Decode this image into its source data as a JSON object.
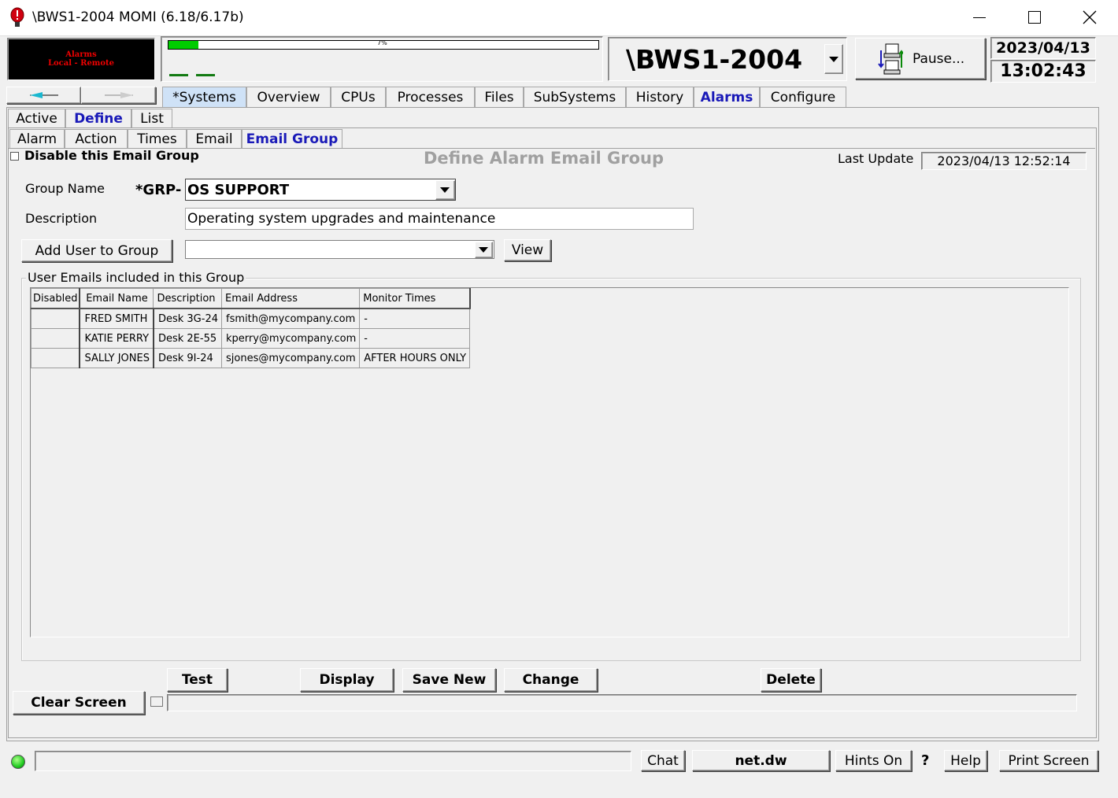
{
  "window": {
    "title": "\\BWS1-2004 MOMI (6.18/6.17b)",
    "minimize_icon": "minimize-icon",
    "maximize_icon": "maximize-icon",
    "close_icon": "close-icon"
  },
  "header": {
    "alarm_panel": {
      "line1": "Alarms",
      "line2": "Local - Remote"
    },
    "progress": {
      "label": "7%",
      "value": 0.07
    },
    "system": "\\BWS1-2004",
    "pause_label": "Pause...",
    "date": "2023/04/13",
    "time": "13:02:43"
  },
  "main_tabs": [
    {
      "label": "*Systems"
    },
    {
      "label": "Overview"
    },
    {
      "label": "CPUs"
    },
    {
      "label": "Processes"
    },
    {
      "label": "Files"
    },
    {
      "label": "SubSystems"
    },
    {
      "label": "History"
    },
    {
      "label": "Alarms"
    },
    {
      "label": "Configure"
    }
  ],
  "sub_tabs": [
    {
      "label": "Active"
    },
    {
      "label": "Define"
    },
    {
      "label": "List"
    }
  ],
  "define_tabs": [
    {
      "label": "Alarm"
    },
    {
      "label": "Action"
    },
    {
      "label": "Times"
    },
    {
      "label": "Email"
    },
    {
      "label": "Email Group"
    }
  ],
  "form": {
    "disable_label": "Disable this Email Group",
    "title": "Define Alarm Email Group",
    "last_update_label": "Last Update",
    "last_update_value": "2023/04/13 12:52:14",
    "group_name_label": "Group Name",
    "group_prefix": "*GRP-",
    "group_name_value": "OS SUPPORT",
    "description_label": "Description",
    "description_value": "Operating system upgrades and maintenance",
    "add_user_label": "Add User to Group",
    "add_user_value": "",
    "view_label": "View",
    "group_box_label": "User Emails included in this Group"
  },
  "table": {
    "columns": [
      "Disabled",
      "Email Name",
      "Description",
      "Email Address",
      "Monitor Times"
    ],
    "rows": [
      [
        "",
        "FRED SMITH",
        "Desk 3G-24",
        "fsmith@mycompany.com",
        "-"
      ],
      [
        "",
        "KATIE PERRY",
        "Desk 2E-55",
        "kperry@mycompany.com",
        "-"
      ],
      [
        "",
        "SALLY JONES",
        "Desk 9I-24",
        "sjones@mycompany.com",
        "AFTER HOURS ONLY"
      ]
    ]
  },
  "actions": {
    "test": "Test",
    "display": "Display",
    "save_new": "Save New",
    "change": "Change",
    "delete": "Delete",
    "clear_screen": "Clear Screen"
  },
  "status_bar": {
    "chat": "Chat",
    "net": "net.dw",
    "hints": "Hints On",
    "question": "?",
    "help": "Help",
    "print": "Print Screen"
  },
  "colors": {
    "accent": "#1a1ab8",
    "progress": "#00cc00",
    "status_led": "#22cc22"
  }
}
